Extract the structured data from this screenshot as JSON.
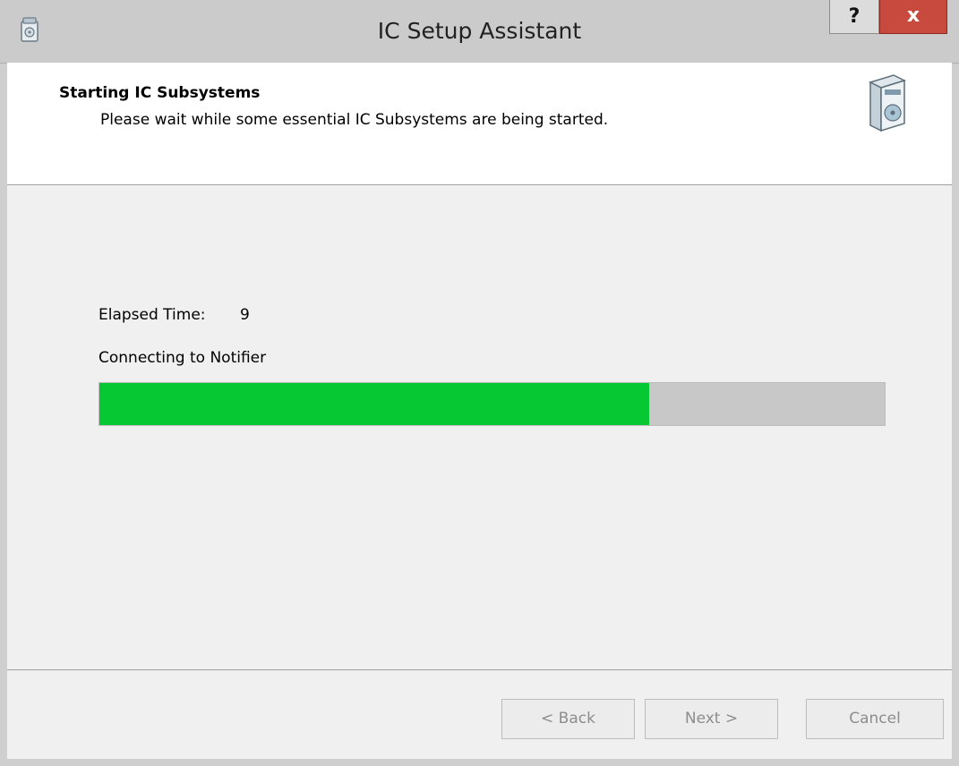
{
  "window": {
    "title": "IC Setup Assistant",
    "help_label": "?",
    "close_label": "x"
  },
  "header": {
    "title": "Starting IC Subsystems",
    "subtitle": "Please wait while some essential IC Subsystems are being started."
  },
  "main": {
    "elapsed_label": "Elapsed Time:",
    "elapsed_value": "9",
    "status": "Connecting to Notifier",
    "progress": 0.7
  },
  "footer": {
    "back_label": "< Back",
    "next_label": "Next >",
    "cancel_label": "Cancel"
  },
  "colors": {
    "progress_fill": "#06c832",
    "close_button": "#c84a3e"
  },
  "icons": {
    "app": "setup-box-icon",
    "header": "software-box-icon"
  }
}
